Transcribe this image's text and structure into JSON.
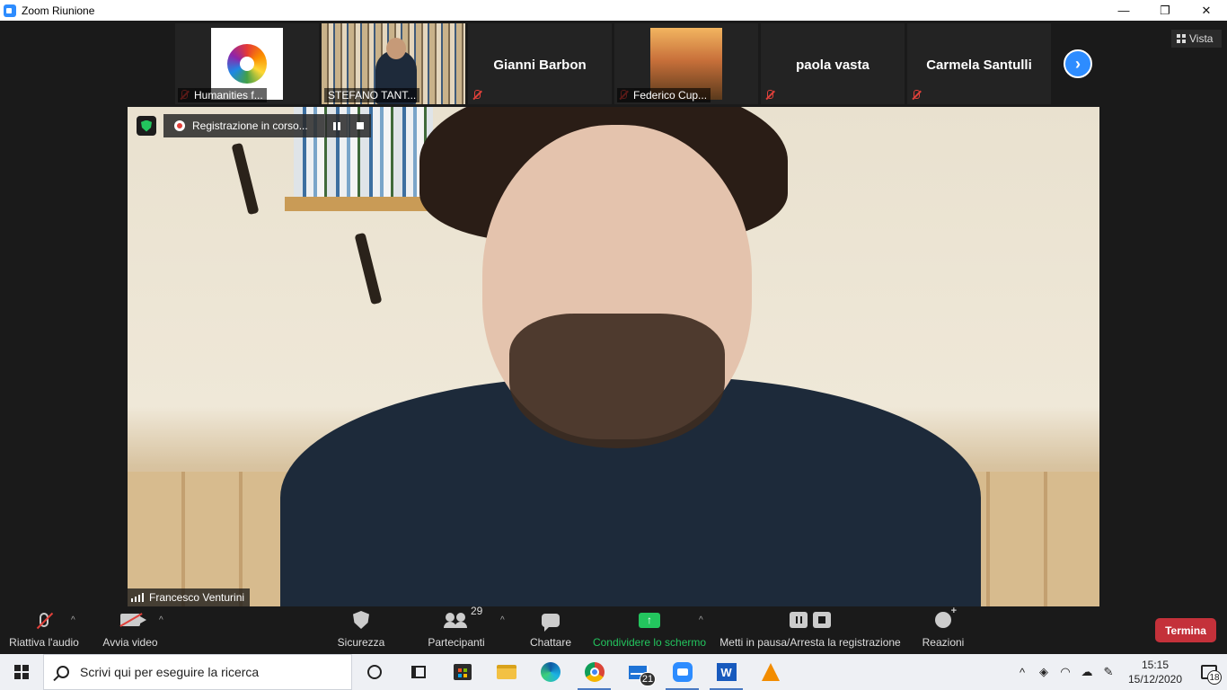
{
  "window": {
    "title": "Zoom Riunione",
    "icon": "zoom-app-icon"
  },
  "window_controls": {
    "minimize": "—",
    "restore": "❐",
    "close": "✕"
  },
  "view_button": {
    "label": "Vista"
  },
  "participants_strip": [
    {
      "name": "Humanities f...",
      "type": "logo",
      "muted": true
    },
    {
      "name": "STEFANO TANT...",
      "type": "video",
      "muted": false
    },
    {
      "name": "Gianni Barbon",
      "type": "name",
      "muted": true
    },
    {
      "name": "Federico Cup...",
      "type": "photo",
      "muted": true
    },
    {
      "name": "paola vasta",
      "type": "name",
      "muted": true
    },
    {
      "name": "Carmela Santulli",
      "type": "name",
      "muted": true
    }
  ],
  "next_page_label": "›",
  "recording_bar": {
    "text": "Registrazione in corso..."
  },
  "speaker": {
    "name": "Francesco Venturini"
  },
  "toolbar": {
    "audio_label": "Riattiva l'audio",
    "video_label": "Avvia video",
    "security_label": "Sicurezza",
    "participants_label": "Partecipanti",
    "participants_count": "29",
    "chat_label": "Chattare",
    "share_label": "Condividere lo schermo",
    "share_arrow": "↑",
    "recording_label": "Metti in pausa/Arresta la registrazione",
    "reactions_label": "Reazioni",
    "end_label": "Termina",
    "caret": "^"
  },
  "taskbar": {
    "search_placeholder": "Scrivi qui per eseguire la ricerca",
    "mail_badge": "21",
    "word_letter": "W",
    "tray_chevron": "^",
    "time": "15:15",
    "date": "15/12/2020",
    "notifications_count": "18"
  },
  "colors": {
    "accent": "#2d8cff",
    "share_green": "#23c55e",
    "end_red": "#c4313a",
    "mute_red": "#e0403a"
  }
}
